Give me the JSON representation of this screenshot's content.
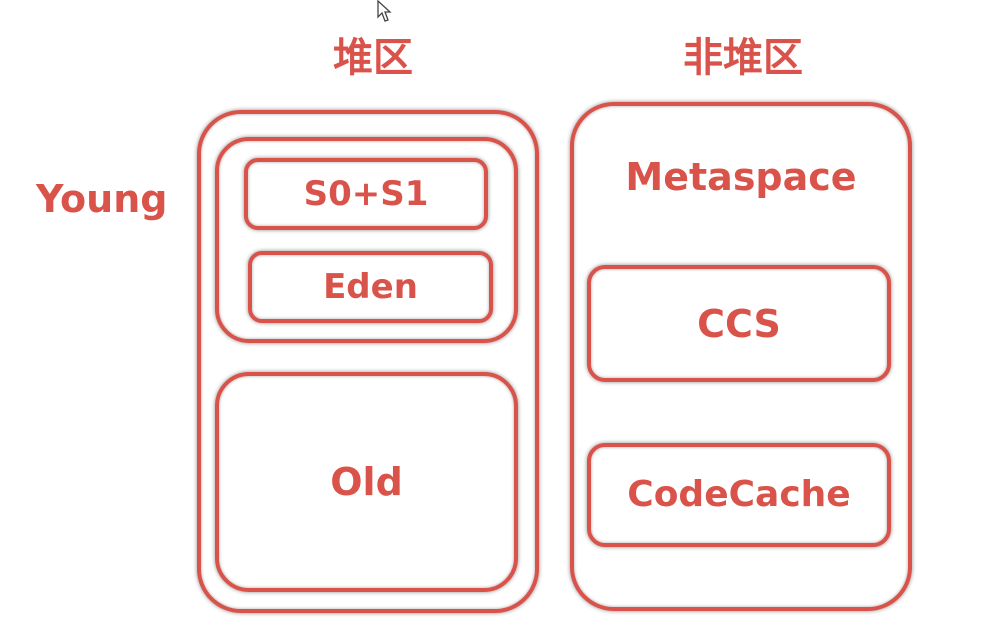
{
  "heap": {
    "title": "堆区",
    "young_label": "Young",
    "survivor_label": "S0+S1",
    "eden_label": "Eden",
    "old_label": "Old"
  },
  "nonheap": {
    "title": "非堆区",
    "metaspace_label": "Metaspace",
    "ccs_label": "CCS",
    "codecache_label": "CodeCache"
  },
  "colors": {
    "accent": "#d9534a"
  }
}
